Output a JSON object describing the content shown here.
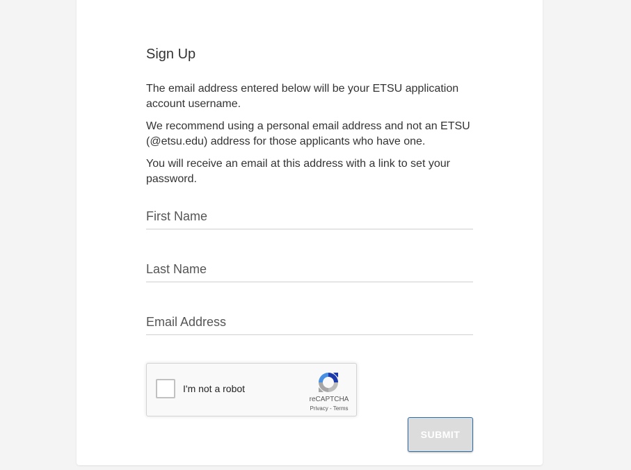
{
  "form": {
    "title": "Sign Up",
    "paragraphs": [
      "The email address entered below will be your ETSU application account username.",
      "We recommend using a personal email address and not an ETSU (@etsu.edu) address for those applicants who have one.",
      "You will receive an email at this address with a link to set your password."
    ],
    "fields": {
      "first_name": {
        "placeholder": "First Name",
        "value": ""
      },
      "last_name": {
        "placeholder": "Last Name",
        "value": ""
      },
      "email": {
        "placeholder": "Email Address",
        "value": ""
      }
    },
    "submit_label": "SUBMIT"
  },
  "captcha": {
    "label": "I'm not a robot",
    "brand": "reCAPTCHA",
    "privacy": "Privacy",
    "separator": " - ",
    "terms": "Terms",
    "checked": false,
    "icon": "recaptcha-icon"
  },
  "colors": {
    "page_bg": "#f4f4f4",
    "card_bg": "#ffffff",
    "submit_bg": "#dcdcdc",
    "submit_border": "#2e6da4"
  }
}
